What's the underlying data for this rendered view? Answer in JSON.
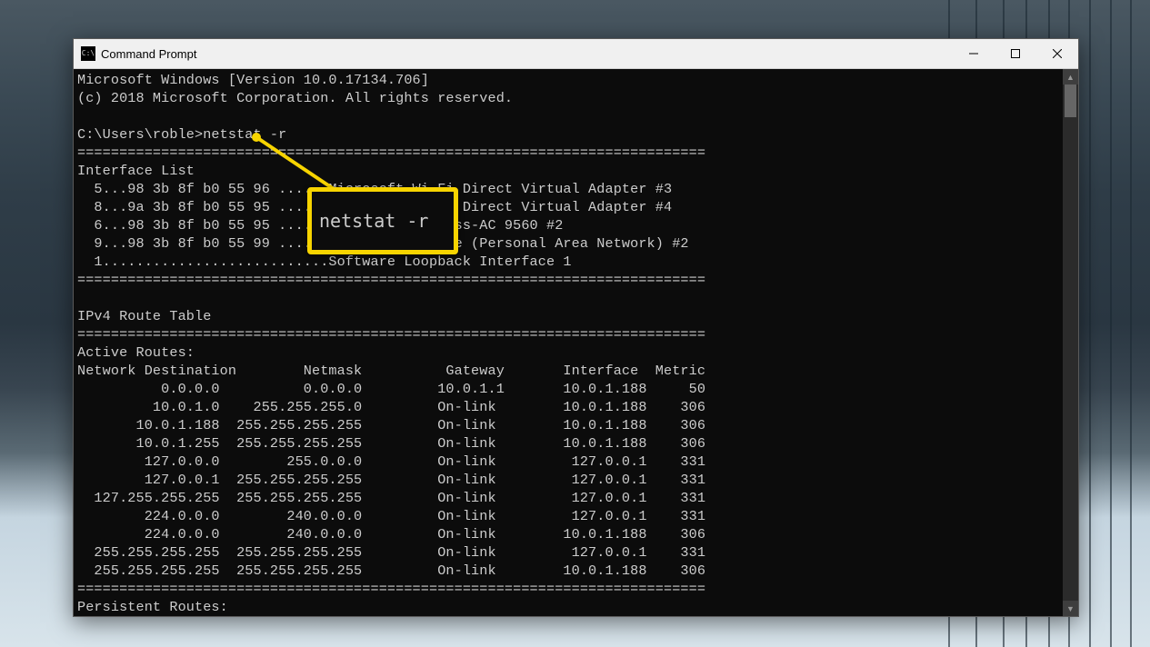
{
  "window": {
    "title": "Command Prompt",
    "icon_label": "C:\\"
  },
  "terminal": {
    "banner_line1": "Microsoft Windows [Version 10.0.17134.706]",
    "banner_line2": "(c) 2018 Microsoft Corporation. All rights reserved.",
    "prompt": "C:\\Users\\roble>",
    "command": "netstat -r",
    "divider": "===========================================================================",
    "interface_header": "Interface List",
    "interfaces": [
      "  5...98 3b 8f b0 55 96 ......Microsoft Wi-Fi Direct Virtual Adapter #3",
      "  8...9a 3b 8f b0 55 95 ......Microsoft Wi-Fi Direct Virtual Adapter #4",
      "  6...98 3b 8f b0 55 95 ......Intel(R) Wireless-AC 9560 #2",
      "  9...98 3b 8f b0 55 99 ......Bluetooth Device (Personal Area Network) #2",
      "  1...........................Software Loopback Interface 1"
    ],
    "ipv4_header": "IPv4 Route Table",
    "active_routes": "Active Routes:",
    "route_columns": "Network Destination        Netmask          Gateway       Interface  Metric",
    "routes": [
      "          0.0.0.0          0.0.0.0         10.0.1.1       10.0.1.188     50",
      "         10.0.1.0    255.255.255.0         On-link        10.0.1.188    306",
      "       10.0.1.188  255.255.255.255         On-link        10.0.1.188    306",
      "       10.0.1.255  255.255.255.255         On-link        10.0.1.188    306",
      "        127.0.0.0        255.0.0.0         On-link         127.0.0.1    331",
      "        127.0.0.1  255.255.255.255         On-link         127.0.0.1    331",
      "  127.255.255.255  255.255.255.255         On-link         127.0.0.1    331",
      "        224.0.0.0        240.0.0.0         On-link         127.0.0.1    331",
      "        224.0.0.0        240.0.0.0         On-link        10.0.1.188    306",
      "  255.255.255.255  255.255.255.255         On-link         127.0.0.1    331",
      "  255.255.255.255  255.255.255.255         On-link        10.0.1.188    306"
    ],
    "divider_short": "===========================================================================",
    "persistent_header": "Persistent Routes:"
  },
  "callout": {
    "text": "netstat -r"
  }
}
